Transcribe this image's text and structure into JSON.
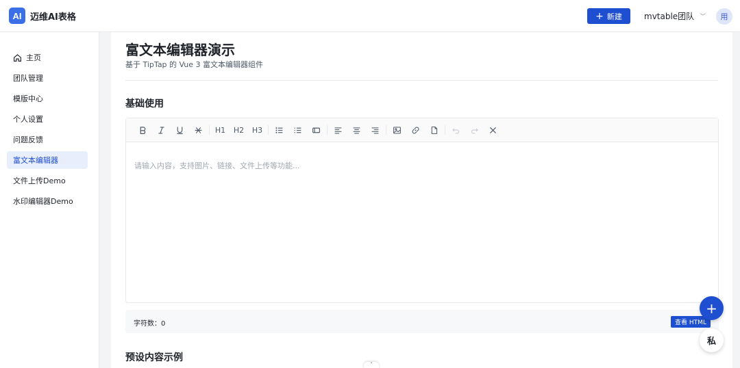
{
  "app": {
    "logo": "AI",
    "title": "迈维AI表格"
  },
  "header": {
    "new_label": "新建",
    "new_icon": "plus-icon",
    "team": "mvtable团队",
    "avatar": "用"
  },
  "sidebar": {
    "items": [
      {
        "label": "主页",
        "icon": "home-icon"
      },
      {
        "label": "团队管理"
      },
      {
        "label": "模版中心"
      },
      {
        "label": "个人设置"
      },
      {
        "label": "问题反馈"
      },
      {
        "label": "富文本编辑器",
        "active": true
      },
      {
        "label": "文件上传Demo"
      },
      {
        "label": "水印编辑器Demo"
      }
    ]
  },
  "main": {
    "title": "富文本编辑器演示",
    "subtitle": "基于 TipTap 的 Vue 3 富文本编辑器组件",
    "section1": "基础使用",
    "section2": "预设内容示例",
    "editor": {
      "toolbar": {
        "h1": "H1",
        "h2": "H2",
        "h3": "H3"
      },
      "placeholder": "请输入内容，支持图片、链接、文件上传等功能..."
    },
    "footer": {
      "char_count": "字符数：0",
      "view_html": "查看 HTML"
    }
  },
  "fab": {
    "icon": "plus-icon",
    "label": "+"
  },
  "private": {
    "label": "私"
  },
  "colors": {
    "accent": "#1f4fd1",
    "logo": "#3b6fe8",
    "active_bg": "#e8eefc"
  }
}
